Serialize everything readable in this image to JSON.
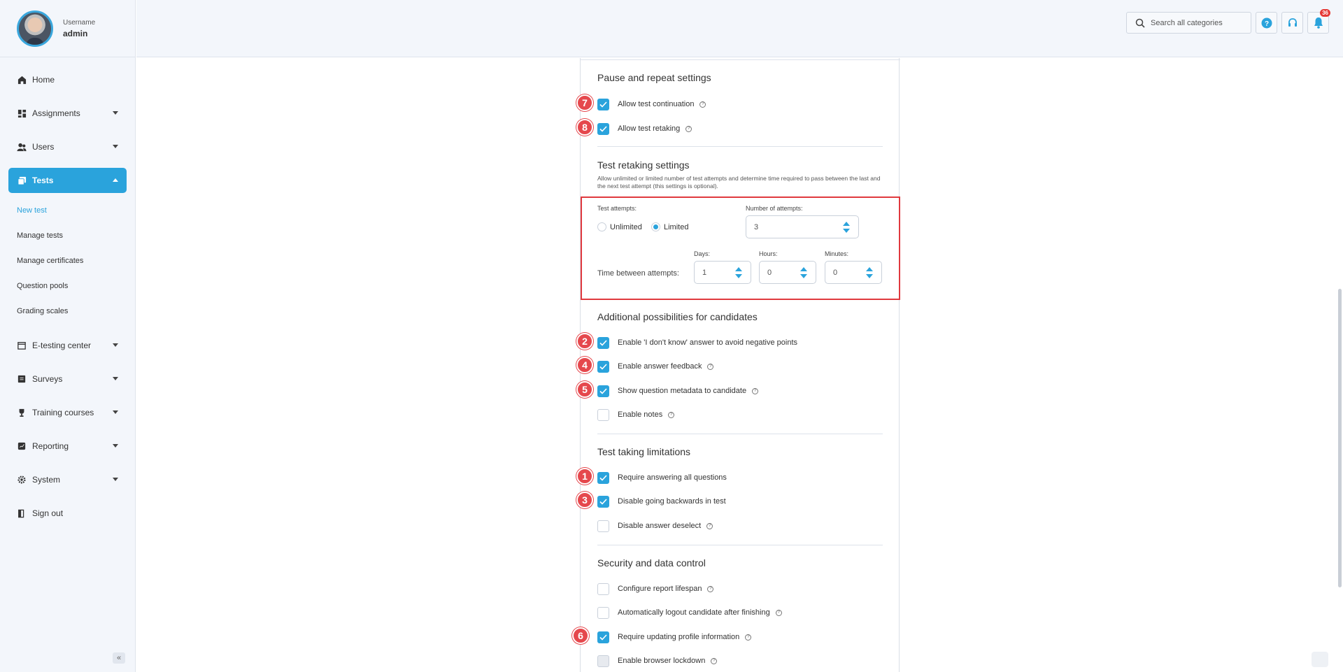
{
  "user": {
    "label": "Username",
    "name": "admin"
  },
  "sidebar": {
    "items": [
      {
        "label": "Home",
        "icon": "home-icon"
      },
      {
        "label": "Assignments",
        "icon": "dashboard-icon"
      },
      {
        "label": "Users",
        "icon": "users-icon"
      },
      {
        "label": "Tests",
        "icon": "tests-icon"
      },
      {
        "label": "E-testing center",
        "icon": "calendar-icon"
      },
      {
        "label": "Surveys",
        "icon": "survey-icon"
      },
      {
        "label": "Training courses",
        "icon": "trophy-icon"
      },
      {
        "label": "Reporting",
        "icon": "report-icon"
      },
      {
        "label": "System",
        "icon": "gear-icon"
      },
      {
        "label": "Sign out",
        "icon": "signout-icon"
      }
    ],
    "subitems": [
      "New test",
      "Manage tests",
      "Manage certificates",
      "Question pools",
      "Grading scales"
    ]
  },
  "topbar": {
    "search_placeholder": "Search all categories",
    "notification_count": "36"
  },
  "sections": {
    "pause": {
      "title": "Pause and repeat settings",
      "items": [
        {
          "label": "Allow test continuation",
          "checked": true,
          "marker": "7"
        },
        {
          "label": "Allow test retaking",
          "checked": true,
          "marker": "8"
        }
      ]
    },
    "retake": {
      "title": "Test retaking settings",
      "description": "Allow unlimited or limited number of test attempts and determine time required to pass between the last and the next test attempt (this settings is optional).",
      "attempts_label": "Test attempts:",
      "unlimited": "Unlimited",
      "limited": "Limited",
      "selected": "Limited",
      "number_label": "Number of attempts:",
      "number_value": "3",
      "time_label": "Time between attempts:",
      "days_label": "Days:",
      "days_value": "1",
      "hours_label": "Hours:",
      "hours_value": "0",
      "minutes_label": "Minutes:",
      "minutes_value": "0"
    },
    "additional": {
      "title": "Additional possibilities for candidates",
      "items": [
        {
          "label": "Enable 'I don't know' answer to avoid negative points",
          "checked": true,
          "marker": "2"
        },
        {
          "label": "Enable answer feedback",
          "checked": true,
          "marker": "4"
        },
        {
          "label": "Show question metadata to candidate",
          "checked": true,
          "marker": "5"
        },
        {
          "label": "Enable notes",
          "checked": false
        }
      ]
    },
    "limitations": {
      "title": "Test taking limitations",
      "items": [
        {
          "label": "Require answering all questions",
          "checked": true,
          "marker": "1"
        },
        {
          "label": "Disable going backwards in test",
          "checked": true,
          "marker": "3"
        },
        {
          "label": "Disable answer deselect",
          "checked": false
        }
      ]
    },
    "security": {
      "title": "Security and data control",
      "items": [
        {
          "label": "Configure report lifespan",
          "checked": false
        },
        {
          "label": "Automatically logout candidate after finishing",
          "checked": false
        },
        {
          "label": "Require updating profile information",
          "checked": true,
          "marker": "6"
        },
        {
          "label": "Enable browser lockdown",
          "checked": false
        }
      ]
    }
  },
  "colors": {
    "accent": "#2aa3dc",
    "marker": "#e5484d",
    "highlight_box": "#e0393e"
  }
}
